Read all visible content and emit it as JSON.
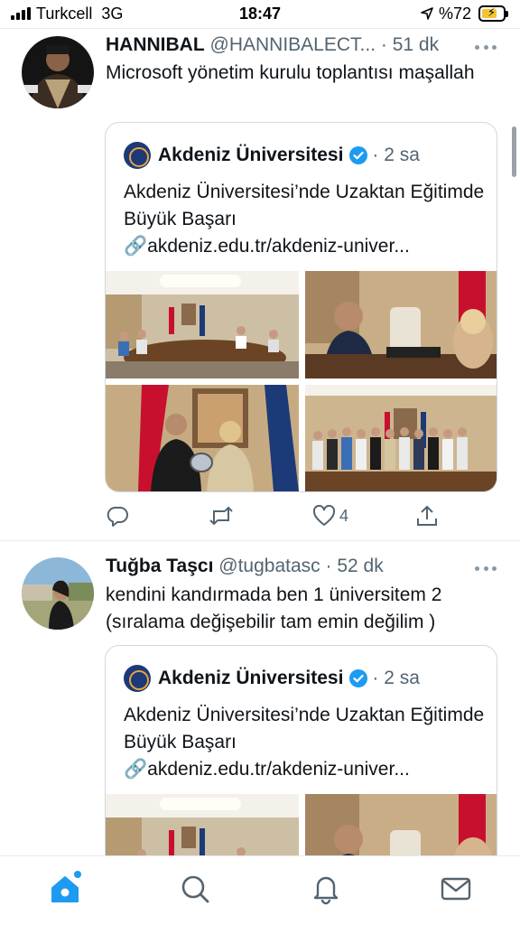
{
  "status_bar": {
    "carrier": "Turkcell",
    "network": "3G",
    "time": "18:47",
    "battery": "%72",
    "battery_level": 0.72
  },
  "colors": {
    "accent": "#1d9bf0",
    "text_primary": "#0f1419",
    "text_secondary": "#536471",
    "border": "#cfd9de",
    "like_red": "#f91880"
  },
  "tweets": [
    {
      "name": "HANNIBAL",
      "handle": "@HANNIBALECT...",
      "time": "· 51 dk",
      "text": "Microsoft yönetim kurulu toplantısı maşallah",
      "quote": {
        "name": "Akdeniz Üniversitesi",
        "time": "· 2 sa",
        "text": "Akdeniz Üniversitesi’nde Uzaktan Eğitimde Büyük Başarı",
        "link": "akdeniz.edu.tr/akdeniz-univer...",
        "link_icon": "🔗",
        "photos": [
          "meeting-room-group",
          "man-at-desk",
          "plaque-presentation",
          "group-photo"
        ]
      },
      "actions": {
        "reply": "",
        "retweet": "",
        "like": "4",
        "share": ""
      }
    },
    {
      "name": "Tuğba Taşcı",
      "handle": "@tugbatasc",
      "time": "· 52 dk",
      "text": "kendini kandırmada ben 1 üniversitem 2 (sıralama değişebilir tam emin değilim )",
      "quote": {
        "name": "Akdeniz Üniversitesi",
        "time": "· 2 sa",
        "text": "Akdeniz Üniversitesi’nde Uzaktan Eğitimde Büyük Başarı",
        "link": "akdeniz.edu.tr/akdeniz-univer...",
        "link_icon": "🔗",
        "photos": [
          "meeting-room-group",
          "man-at-desk"
        ]
      }
    }
  ],
  "tab_bar": {
    "items": [
      "home-icon",
      "search-icon",
      "notifications-icon",
      "messages-icon"
    ]
  }
}
